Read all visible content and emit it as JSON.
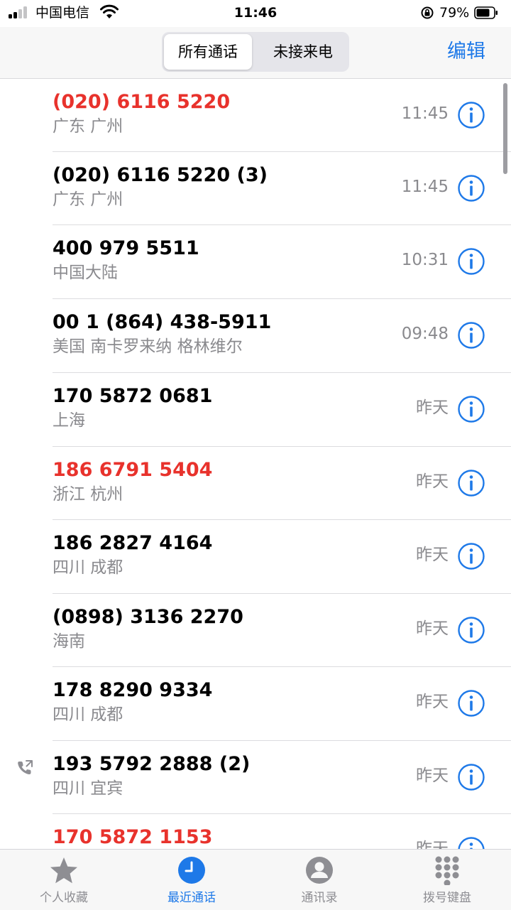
{
  "status_bar": {
    "carrier": "中国电信",
    "time": "11:46",
    "battery_percent": "79%"
  },
  "header": {
    "segments": [
      "所有通话",
      "未接来电"
    ],
    "selected_segment": "所有通话",
    "edit_label": "编辑"
  },
  "calls": [
    {
      "number": "(020) 6116 5220",
      "location": "广东 广州",
      "time": "11:45",
      "missed": true,
      "outgoing": false
    },
    {
      "number": "(020) 6116 5220 (3)",
      "location": "广东 广州",
      "time": "11:45",
      "missed": false,
      "outgoing": false
    },
    {
      "number": "400 979 5511",
      "location": "中国大陆",
      "time": "10:31",
      "missed": false,
      "outgoing": false
    },
    {
      "number": "00 1 (864) 438-5911",
      "location": "美国 南卡罗来纳 格林维尔",
      "time": "09:48",
      "missed": false,
      "outgoing": false
    },
    {
      "number": "170 5872 0681",
      "location": "上海",
      "time": "昨天",
      "missed": false,
      "outgoing": false
    },
    {
      "number": "186 6791 5404",
      "location": "浙江 杭州",
      "time": "昨天",
      "missed": true,
      "outgoing": false
    },
    {
      "number": "186 2827 4164",
      "location": "四川 成都",
      "time": "昨天",
      "missed": false,
      "outgoing": false
    },
    {
      "number": "(0898) 3136 2270",
      "location": "海南",
      "time": "昨天",
      "missed": false,
      "outgoing": false
    },
    {
      "number": "178 8290 9334",
      "location": "四川 成都",
      "time": "昨天",
      "missed": false,
      "outgoing": false
    },
    {
      "number": "193 5792 2888 (2)",
      "location": "四川 宜宾",
      "time": "昨天",
      "missed": false,
      "outgoing": true
    },
    {
      "number": "170 5872 1153",
      "location": "",
      "time": "昨天",
      "missed": true,
      "outgoing": false
    }
  ],
  "tabs": [
    {
      "label": "个人收藏",
      "icon": "star-icon",
      "active": false
    },
    {
      "label": "最近通话",
      "icon": "clock-icon",
      "active": true
    },
    {
      "label": "通讯录",
      "icon": "person-icon",
      "active": false
    },
    {
      "label": "拨号键盘",
      "icon": "keypad-icon",
      "active": false
    }
  ],
  "colors": {
    "accent": "#1e79e8",
    "missed": "#e8322c",
    "secondary_text": "#8a8a8e"
  }
}
